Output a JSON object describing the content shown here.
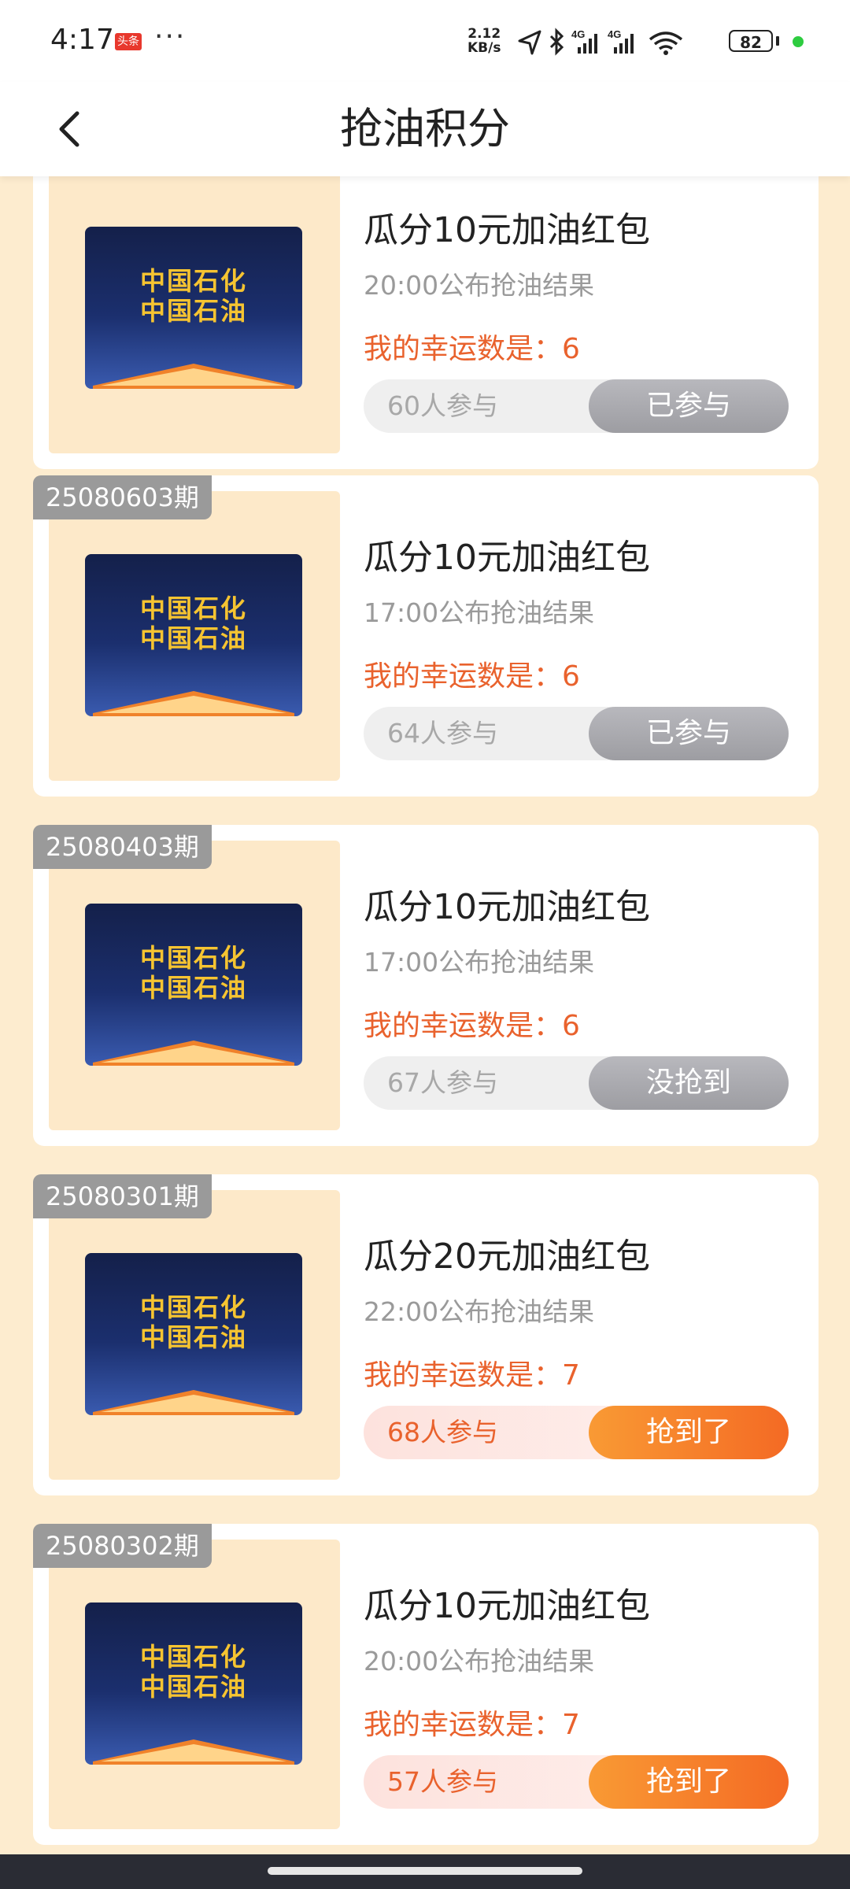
{
  "status_bar": {
    "time": "4:17",
    "toutiao_badge": "头条",
    "dots": "···",
    "net_speed_value": "2.12",
    "net_speed_unit": "KB/s",
    "signal_1": "4G",
    "signal_2": "4G",
    "battery": "82",
    "dot_color": "#2ecc40"
  },
  "header": {
    "title": "抢油积分",
    "back_icon": "chevron-left-icon"
  },
  "cards": [
    {
      "period": "",
      "brand_line1": "中国石化",
      "brand_line2": "中国石油",
      "title": "瓜分10元加油红包",
      "time": "20:00公布抢油结果",
      "lucky": "我的幸运数是：6",
      "participants": "60人参与",
      "status": "已参与",
      "won": false
    },
    {
      "period": "25080603期",
      "brand_line1": "中国石化",
      "brand_line2": "中国石油",
      "title": "瓜分10元加油红包",
      "time": "17:00公布抢油结果",
      "lucky": "我的幸运数是：6",
      "participants": "64人参与",
      "status": "已参与",
      "won": false
    },
    {
      "period": "25080403期",
      "brand_line1": "中国石化",
      "brand_line2": "中国石油",
      "title": "瓜分10元加油红包",
      "time": "17:00公布抢油结果",
      "lucky": "我的幸运数是：6",
      "participants": "67人参与",
      "status": "没抢到",
      "won": false
    },
    {
      "period": "25080301期",
      "brand_line1": "中国石化",
      "brand_line2": "中国石油",
      "title": "瓜分20元加油红包",
      "time": "22:00公布抢油结果",
      "lucky": "我的幸运数是：7",
      "participants": "68人参与",
      "status": "抢到了",
      "won": true
    },
    {
      "period": "25080302期",
      "brand_line1": "中国石化",
      "brand_line2": "中国石油",
      "title": "瓜分10元加油红包",
      "time": "20:00公布抢油结果",
      "lucky": "我的幸运数是：7",
      "participants": "57人参与",
      "status": "抢到了",
      "won": true
    }
  ],
  "colors": {
    "page_bg": "#fdeccf",
    "accent_orange": "#f46a24",
    "lucky_text": "#e9622d",
    "brand_text": "#f6c431",
    "period_tag": "#9a9a9a"
  }
}
